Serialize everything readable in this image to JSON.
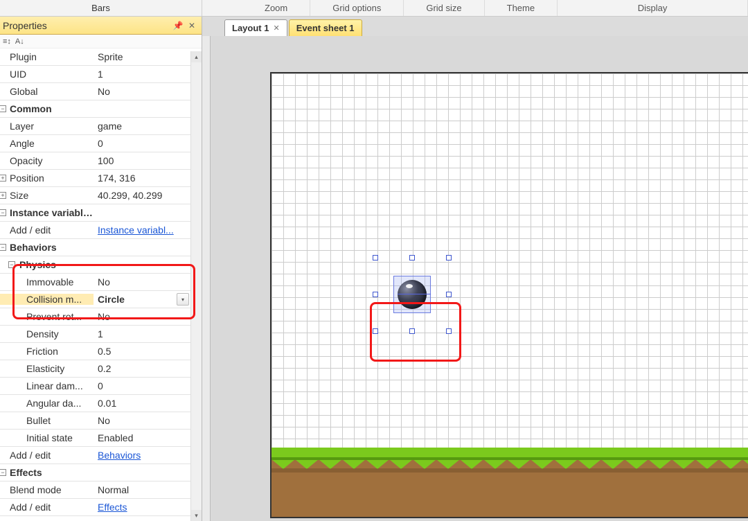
{
  "topbar": {
    "left_label": "Bars",
    "items": [
      "Zoom",
      "Grid options",
      "Grid size",
      "Theme",
      "Display"
    ]
  },
  "tabs": {
    "layout": "Layout 1",
    "event": "Event sheet 1"
  },
  "panel": {
    "title": "Properties"
  },
  "props": {
    "plugin_k": "Plugin",
    "plugin_v": "Sprite",
    "uid_k": "UID",
    "uid_v": "1",
    "global_k": "Global",
    "global_v": "No",
    "common_k": "Common",
    "layer_k": "Layer",
    "layer_v": "game",
    "angle_k": "Angle",
    "angle_v": "0",
    "opacity_k": "Opacity",
    "opacity_v": "100",
    "position_k": "Position",
    "position_v": "174, 316",
    "size_k": "Size",
    "size_v": "40.299, 40.299",
    "instvars_k": "Instance variables",
    "addedit_k": "Add / edit",
    "instvars_link": "Instance variabl...",
    "behaviors_k": "Behaviors",
    "physics_k": "Physics",
    "immovable_k": "Immovable",
    "immovable_v": "No",
    "collision_k": "Collision m...",
    "collision_v": "Circle",
    "prevent_k": "Prevent rot...",
    "prevent_v": "No",
    "density_k": "Density",
    "density_v": "1",
    "friction_k": "Friction",
    "friction_v": "0.5",
    "elasticity_k": "Elasticity",
    "elasticity_v": "0.2",
    "lineardamp_k": "Linear dam...",
    "lineardamp_v": "0",
    "angulardamp_k": "Angular da...",
    "angulardamp_v": "0.01",
    "bullet_k": "Bullet",
    "bullet_v": "No",
    "initstate_k": "Initial state",
    "initstate_v": "Enabled",
    "behaviors_link": "Behaviors",
    "effects_k": "Effects",
    "blend_k": "Blend mode",
    "blend_v": "Normal",
    "effects_link": "Effects"
  }
}
